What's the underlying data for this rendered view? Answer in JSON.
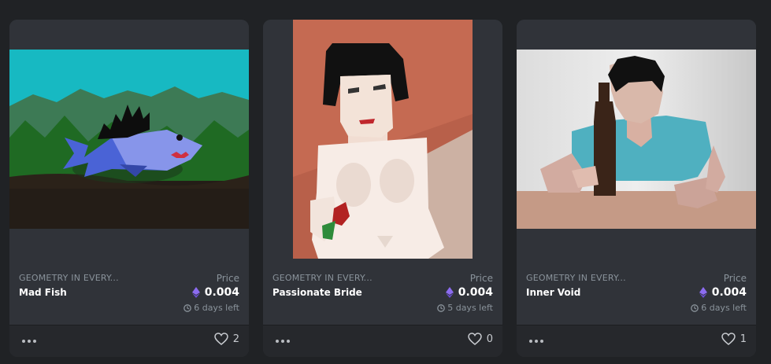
{
  "cards": [
    {
      "collection": "GEOMETRY IN EVERY...",
      "name": "Mad Fish",
      "price_label": "Price",
      "price": "0.004",
      "time_left": "6 days left",
      "likes": "2",
      "image": "mad-fish-artwork"
    },
    {
      "collection": "GEOMETRY IN EVERY...",
      "name": "Passionate Bride",
      "price_label": "Price",
      "price": "0.004",
      "time_left": "5 days left",
      "likes": "0",
      "image": "passionate-bride-artwork"
    },
    {
      "collection": "GEOMETRY IN EVERY...",
      "name": "Inner Void",
      "price_label": "Price",
      "price": "0.004",
      "time_left": "6 days left",
      "likes": "1",
      "image": "inner-void-artwork"
    }
  ],
  "colors": {
    "page_bg": "#202225",
    "card_bg": "#303339",
    "footer_bg": "#26282c",
    "muted_text": "#8a939b",
    "eth_purple": "#8c6cf0"
  },
  "icons": [
    "eth-icon",
    "clock-icon",
    "more-icon",
    "heart-icon"
  ]
}
